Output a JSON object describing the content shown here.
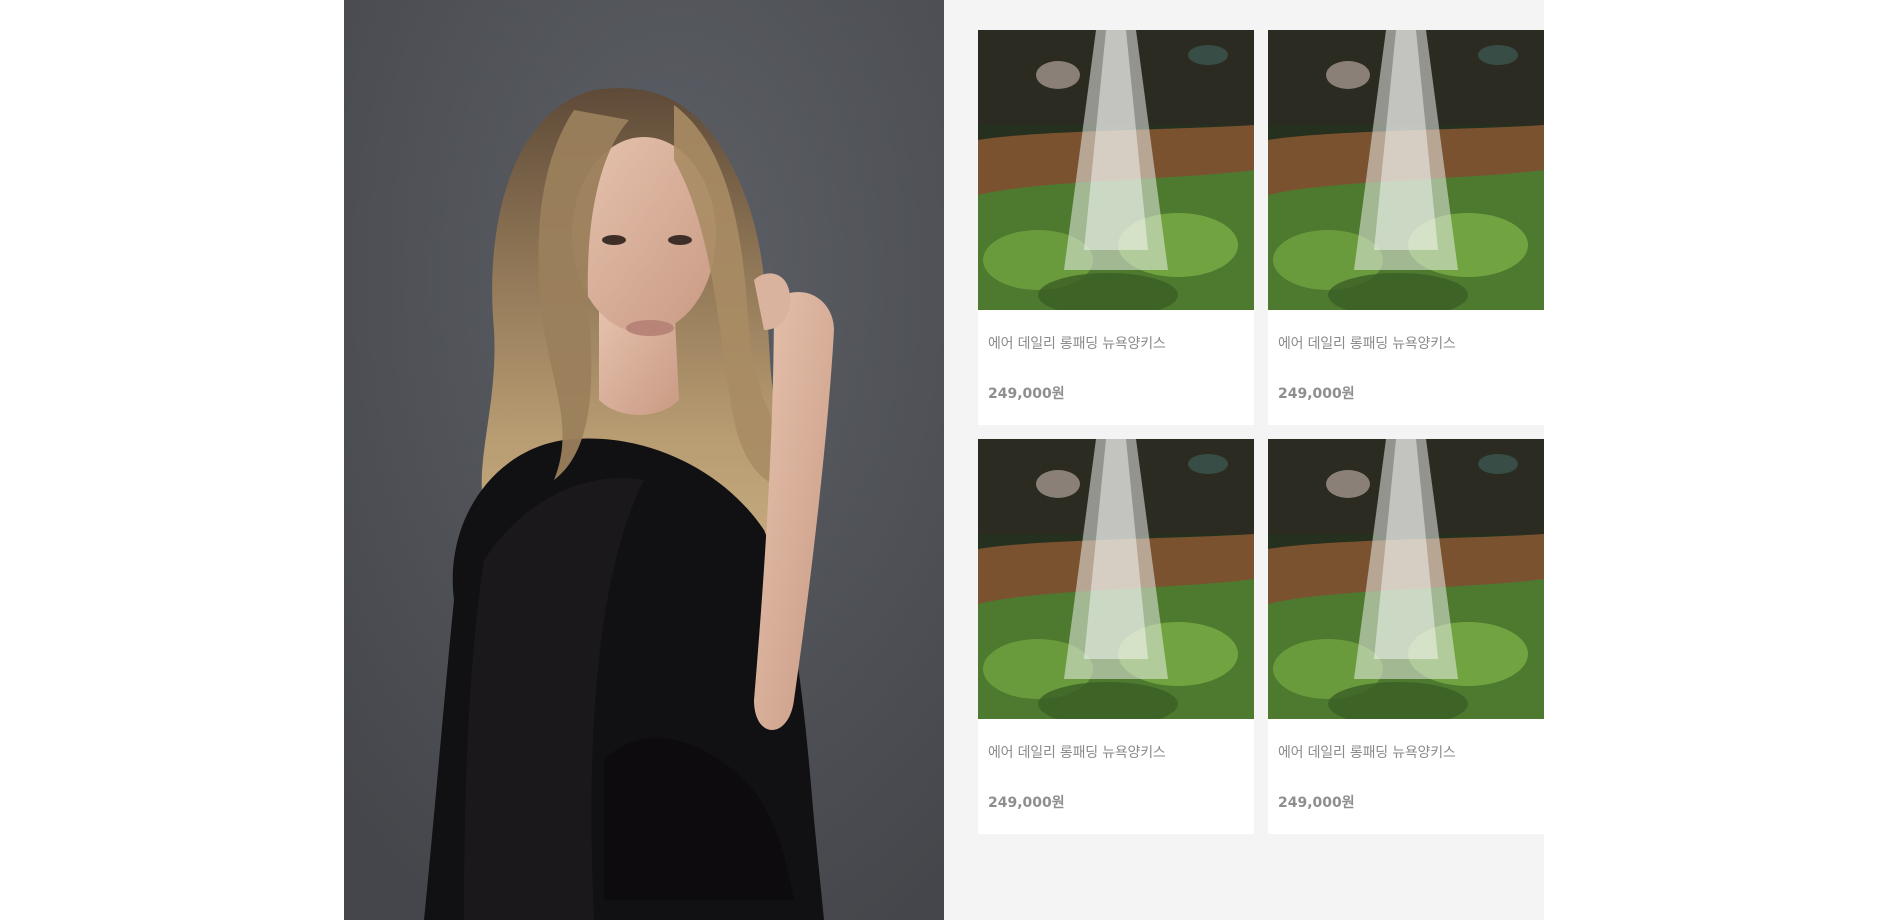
{
  "hero": {
    "image": "portrait-woman-black-sheer-blouse"
  },
  "products": [
    {
      "image": "watering-plants-photo",
      "name": "에어 데일리 롱패딩 뉴욕양키스",
      "price": "249,000원"
    },
    {
      "image": "watering-plants-photo",
      "name": "에어 데일리 롱패딩 뉴욕양키스",
      "price": "249,000원"
    },
    {
      "image": "watering-plants-photo",
      "name": "에어 데일리 롱패딩 뉴욕양키스",
      "price": "249,000원"
    },
    {
      "image": "watering-plants-photo",
      "name": "에어 데일리 롱패딩 뉴욕양키스",
      "price": "249,000원"
    }
  ],
  "colors": {
    "section_bg": "#f4f4f4",
    "card_bg": "#ffffff",
    "text_gray": "#8a8a8a"
  }
}
